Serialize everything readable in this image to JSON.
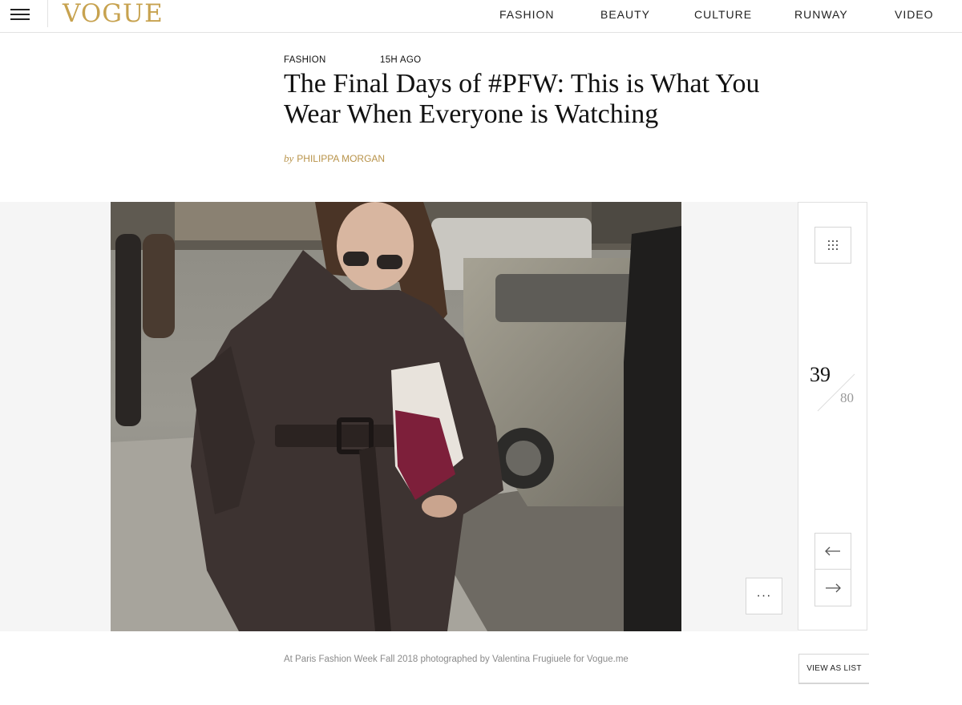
{
  "header": {
    "logo": "VOGUE",
    "nav": [
      "FASHION",
      "BEAUTY",
      "CULTURE",
      "RUNWAY",
      "VIDEO"
    ]
  },
  "article": {
    "category": "FASHION",
    "time_ago": "15H AGO",
    "title": "The Final Days of #PFW: This is What You Wear When Everyone is Watching",
    "byline_prefix": "by",
    "author": "PHILIPPA MORGAN"
  },
  "gallery": {
    "current": "39",
    "total": "80",
    "more_label": "···",
    "caption": "At Paris Fashion Week Fall 2018 photographed by Valentina Frugiuele for Vogue.me",
    "view_as_list": "VIEW AS LIST",
    "icons": {
      "menu": "hamburger-menu-icon",
      "grid": "grid-icon",
      "prev": "arrow-left-icon",
      "next": "arrow-right-icon"
    }
  },
  "colors": {
    "brand_gold": "#c7a24f",
    "byline_gold": "#b8934a",
    "coat": "#3d3331",
    "bag": "#7d1f3a"
  }
}
